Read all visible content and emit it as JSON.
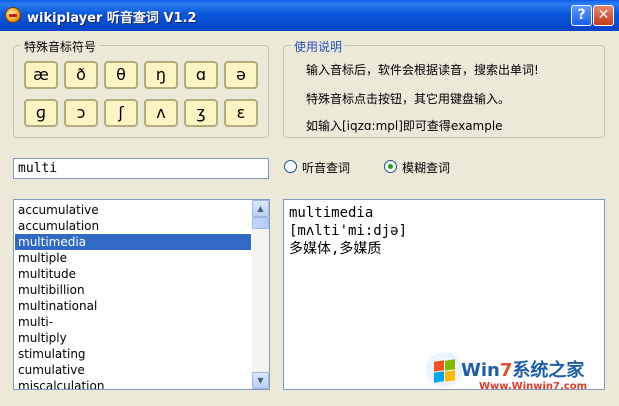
{
  "window": {
    "title": "wikiplayer 听音查词 V1.2",
    "help_btn": "?",
    "close_btn": "✕"
  },
  "phonetic_group": {
    "title": "特殊音标符号",
    "symbols": [
      "æ",
      "ð",
      "θ",
      "ŋ",
      "ɑ",
      "ə",
      "ɡ",
      "ɔ",
      "ʃ",
      "ʌ",
      "ʒ",
      "ɛ"
    ]
  },
  "help_group": {
    "title": "使用说明",
    "lines": [
      "输入音标后，软件会根据读音，搜索出单词!",
      "特殊音标点击按钮，其它用键盘输入。",
      "如输入[iqzɑ:mpl]即可查得example"
    ]
  },
  "search": {
    "value": "multi"
  },
  "mode": {
    "options": [
      "听音查词",
      "模糊查词"
    ],
    "selected": "模糊查词"
  },
  "results_list": {
    "items": [
      "accumulative",
      "accumulation",
      "multimedia",
      "multiple",
      "multitude",
      "multibillion",
      "multinational",
      "multi-",
      "multiply",
      "stimulating",
      "cumulative",
      "miscalculation"
    ],
    "selected_index": 2
  },
  "definition": {
    "word": "multimedia",
    "phonetic": "[mʌlti'mi:djə]",
    "meaning": "多媒体,多媒质"
  },
  "watermark": {
    "brand_w": "Win",
    "brand_7": "7",
    "brand_rest": "系统之家",
    "url": "Www.Winwin7.com"
  }
}
